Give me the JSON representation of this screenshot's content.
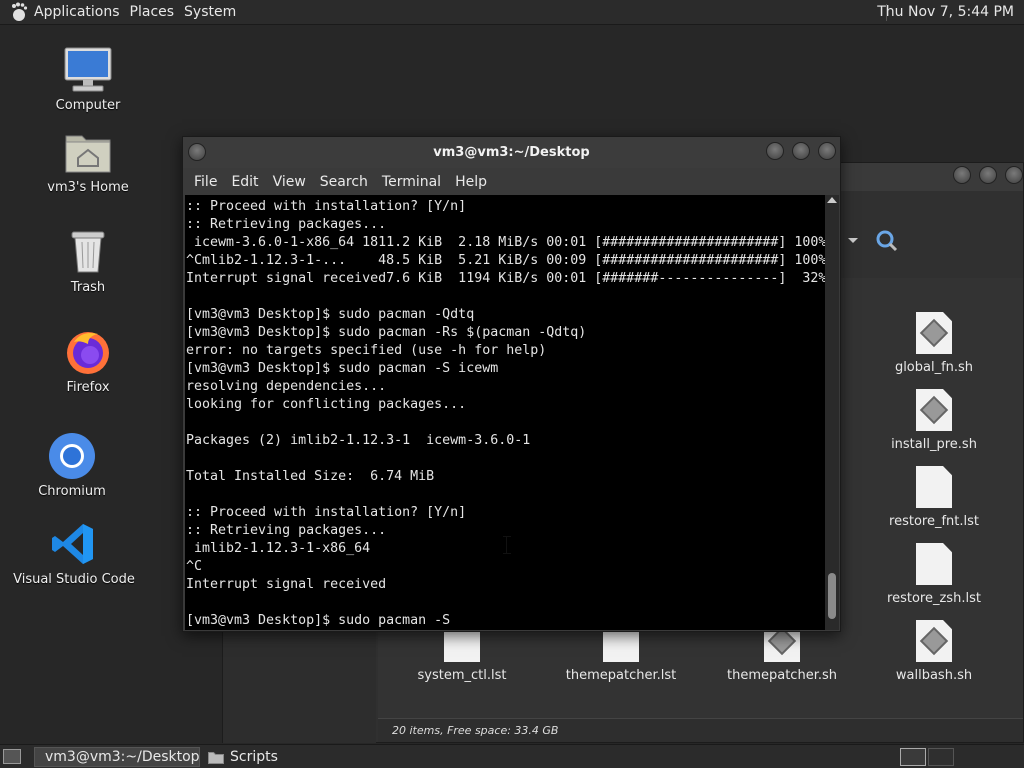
{
  "top_panel": {
    "menus": [
      "Applications",
      "Places",
      "System"
    ],
    "clock": "Thu Nov 7,  5:44 PM"
  },
  "desktop_icons": {
    "computer": "Computer",
    "home": "vm3's Home",
    "trash": "Trash",
    "firefox": "Firefox",
    "chromium": "Chromium",
    "vscode": "Visual Studio Code"
  },
  "file_manager": {
    "files": [
      "global_fn.sh",
      "install_pre.sh",
      "restore_fnt.lst",
      "restore_zsh.lst",
      "system_ctl.lst",
      "themepatcher.lst",
      "themepatcher.sh",
      "wallbash.sh"
    ],
    "status": "20 items, Free space: 33.4 GB"
  },
  "terminal": {
    "title": "vm3@vm3:~/Desktop",
    "menu": [
      "File",
      "Edit",
      "View",
      "Search",
      "Terminal",
      "Help"
    ],
    "lines": [
      ":: Proceed with installation? [Y/n]",
      ":: Retrieving packages...",
      " icewm-3.6.0-1-x86_64 1811.2 KiB  2.18 MiB/s 00:01 [######################] 100%",
      "^Cmlib2-1.12.3-1-...    48.5 KiB  5.21 KiB/s 00:09 [######################] 100%",
      "Interrupt signal received7.6 KiB  1194 KiB/s 00:01 [#######---------------]  32%",
      "",
      "[vm3@vm3 Desktop]$ sudo pacman -Qdtq",
      "[vm3@vm3 Desktop]$ sudo pacman -Rs $(pacman -Qdtq)",
      "error: no targets specified (use -h for help)",
      "[vm3@vm3 Desktop]$ sudo pacman -S icewm",
      "resolving dependencies...",
      "looking for conflicting packages...",
      "",
      "Packages (2) imlib2-1.12.3-1  icewm-3.6.0-1",
      "",
      "Total Installed Size:  6.74 MiB",
      "",
      ":: Proceed with installation? [Y/n]",
      ":: Retrieving packages...",
      " imlib2-1.12.3-1-x86_64",
      "^C",
      "Interrupt signal received",
      "",
      "[vm3@vm3 Desktop]$ sudo pacman -S"
    ]
  },
  "taskbar": {
    "tasks": [
      "vm3@vm3:~/Desktop",
      "Scripts"
    ]
  }
}
